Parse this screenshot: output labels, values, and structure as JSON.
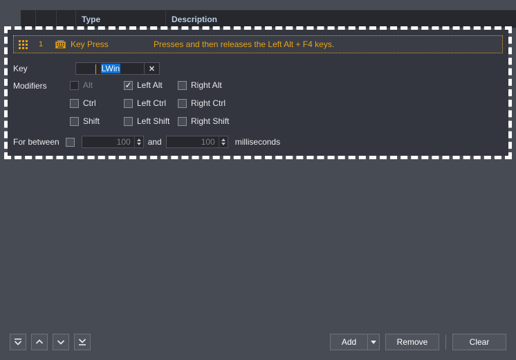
{
  "grid": {
    "headers": {
      "col_handle": "",
      "col_number": "",
      "col_icon": "",
      "type": "Type",
      "description": "Description"
    },
    "rows": [
      {
        "number": "1",
        "icon": "keyboard-icon",
        "type": "Key Press",
        "description": "Presses and then releases the Left Alt + F4 keys."
      }
    ]
  },
  "properties": {
    "key": {
      "label": "Key",
      "value": "LWin",
      "selected": true,
      "clear_label": "✕"
    },
    "modifiers": {
      "label": "Modifiers",
      "items": [
        {
          "label": "Alt",
          "checked": false,
          "disabled": true
        },
        {
          "label": "Left Alt",
          "checked": true,
          "disabled": false
        },
        {
          "label": "Right Alt",
          "checked": false,
          "disabled": false
        },
        {
          "label": "Ctrl",
          "checked": false,
          "disabled": false
        },
        {
          "label": "Left Ctrl",
          "checked": false,
          "disabled": false
        },
        {
          "label": "Right Ctrl",
          "checked": false,
          "disabled": false
        },
        {
          "label": "Shift",
          "checked": false,
          "disabled": false
        },
        {
          "label": "Left Shift",
          "checked": false,
          "disabled": false
        },
        {
          "label": "Right Shift",
          "checked": false,
          "disabled": false
        }
      ]
    },
    "duration": {
      "label": "For between",
      "enabled": false,
      "min_value": "100",
      "conjunction": "and",
      "max_value": "100",
      "unit": "milliseconds"
    }
  },
  "toolbar": {
    "nav": [
      {
        "name": "move-to-top",
        "glyph": "⤒"
      },
      {
        "name": "move-up",
        "glyph": "∧"
      },
      {
        "name": "move-down",
        "glyph": "∨"
      },
      {
        "name": "move-to-bottom",
        "glyph": "⤓"
      }
    ],
    "add_label": "Add",
    "remove_label": "Remove",
    "clear_label": "Clear"
  },
  "colors": {
    "background": "#474b54",
    "panel": "#33363f",
    "header": "#26282e",
    "accent_orange": "#e8a317",
    "selection_blue": "#0f72d4",
    "header_text": "#b9cde0"
  }
}
